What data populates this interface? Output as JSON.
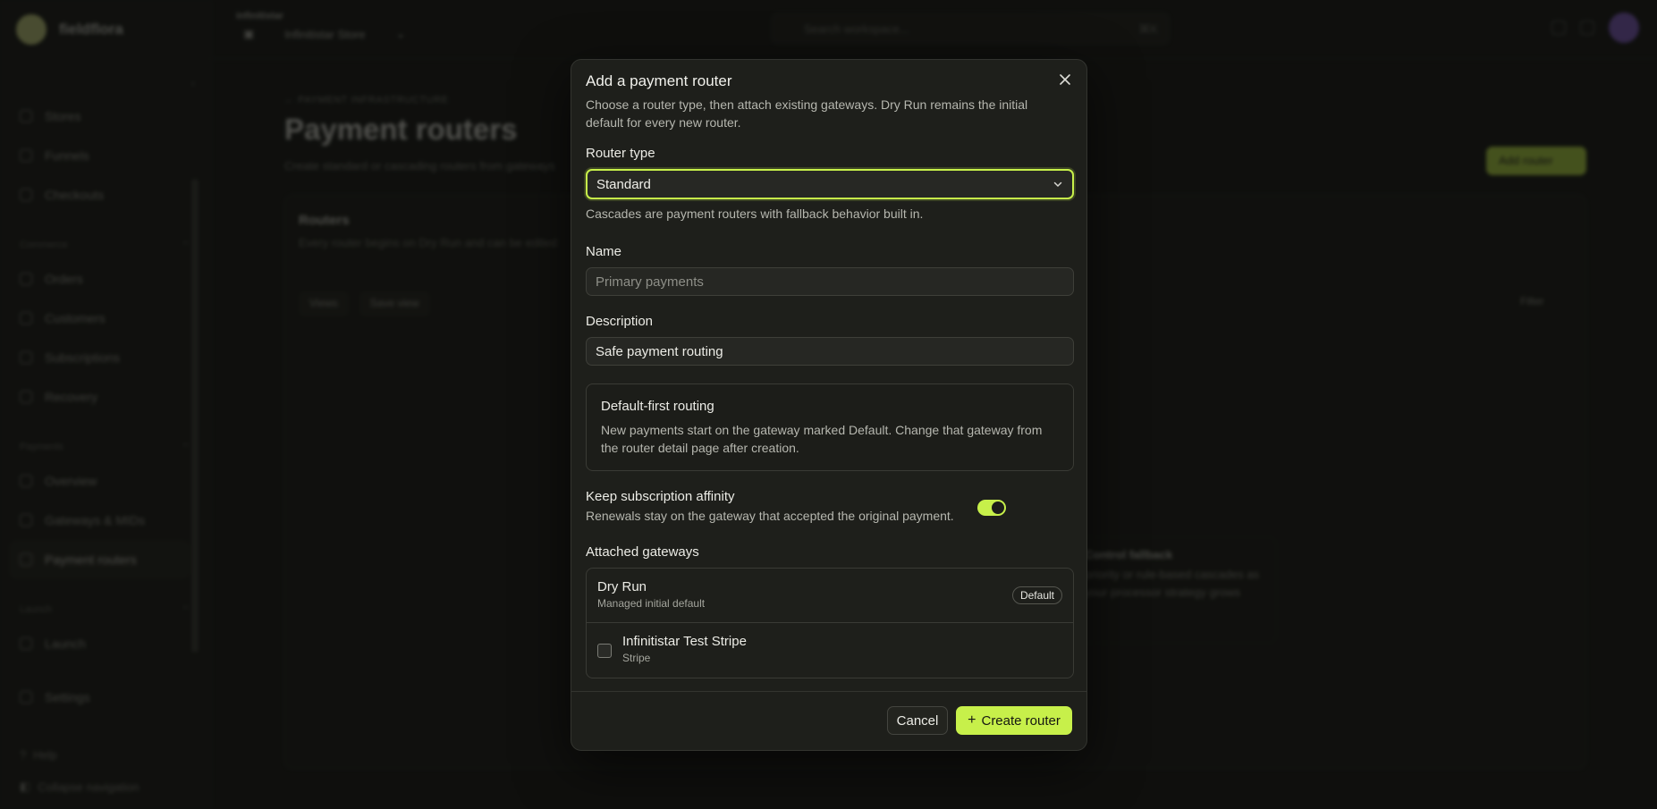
{
  "background": {
    "brand": "fieldflora",
    "org_label": "infinitistar",
    "store_name": "Infinitistar Store",
    "search_placeholder": "Search workspace...",
    "search_shortcut": "⌘K",
    "nav": {
      "top_items": [
        {
          "label": "Stores"
        },
        {
          "label": "Funnels"
        },
        {
          "label": "Checkouts"
        }
      ],
      "commerce_label": "Commerce",
      "commerce_items": [
        {
          "label": "Orders"
        },
        {
          "label": "Customers"
        },
        {
          "label": "Subscriptions"
        },
        {
          "label": "Recovery"
        }
      ],
      "payments_label": "Payments",
      "payments_items": [
        {
          "label": "Overview"
        },
        {
          "label": "Gateways & MIDs"
        },
        {
          "label": "Payment routers"
        }
      ],
      "launch_label": "Launch",
      "launch_items": [
        {
          "label": "Launch"
        },
        {
          "label": "Settings"
        }
      ],
      "help": "Help",
      "collapse": "Collapse navigation"
    },
    "breadcrumb": "← PAYMENT INFRASTRUCTURE",
    "page_title": "Payment routers",
    "page_subtitle": "Create standard or cascading routers from gateways",
    "add_router_button": "Add router",
    "panel_title": "Routers",
    "panel_desc": "Every router begins on Dry Run and can be edited",
    "views_button": "Views",
    "save_view_button": "Save view",
    "filter_button": "Filter",
    "fallback_title": "Control fallback",
    "fallback_text": "priority or rule-based cascades as your processor strategy grows"
  },
  "modal": {
    "title": "Add a payment router",
    "description": "Choose a router type, then attach existing gateways. Dry Run remains the initial default for every new router.",
    "router_type_label": "Router type",
    "router_type_value": "Standard",
    "router_type_helper": "Cascades are payment routers with fallback behavior built in.",
    "name_label": "Name",
    "name_placeholder": "Primary payments",
    "name_value": "",
    "description_label": "Description",
    "description_value": "Safe payment routing",
    "info_title": "Default-first routing",
    "info_text": "New payments start on the gateway marked Default. Change that gateway from the router detail page after creation.",
    "affinity_title": "Keep subscription affinity",
    "affinity_desc": "Renewals stay on the gateway that accepted the original payment.",
    "affinity_on": true,
    "gateways_label": "Attached gateways",
    "gateways": [
      {
        "name": "Dry Run",
        "sub": "Managed initial default",
        "badge": "Default"
      },
      {
        "name": "Infinitistar Test Stripe",
        "sub": "Stripe",
        "checked": false
      }
    ],
    "cancel_label": "Cancel",
    "create_label": "Create router"
  },
  "colors": {
    "accent": "#c7f04a",
    "modal_bg": "#1e1f1b",
    "page_bg": "#141513"
  }
}
